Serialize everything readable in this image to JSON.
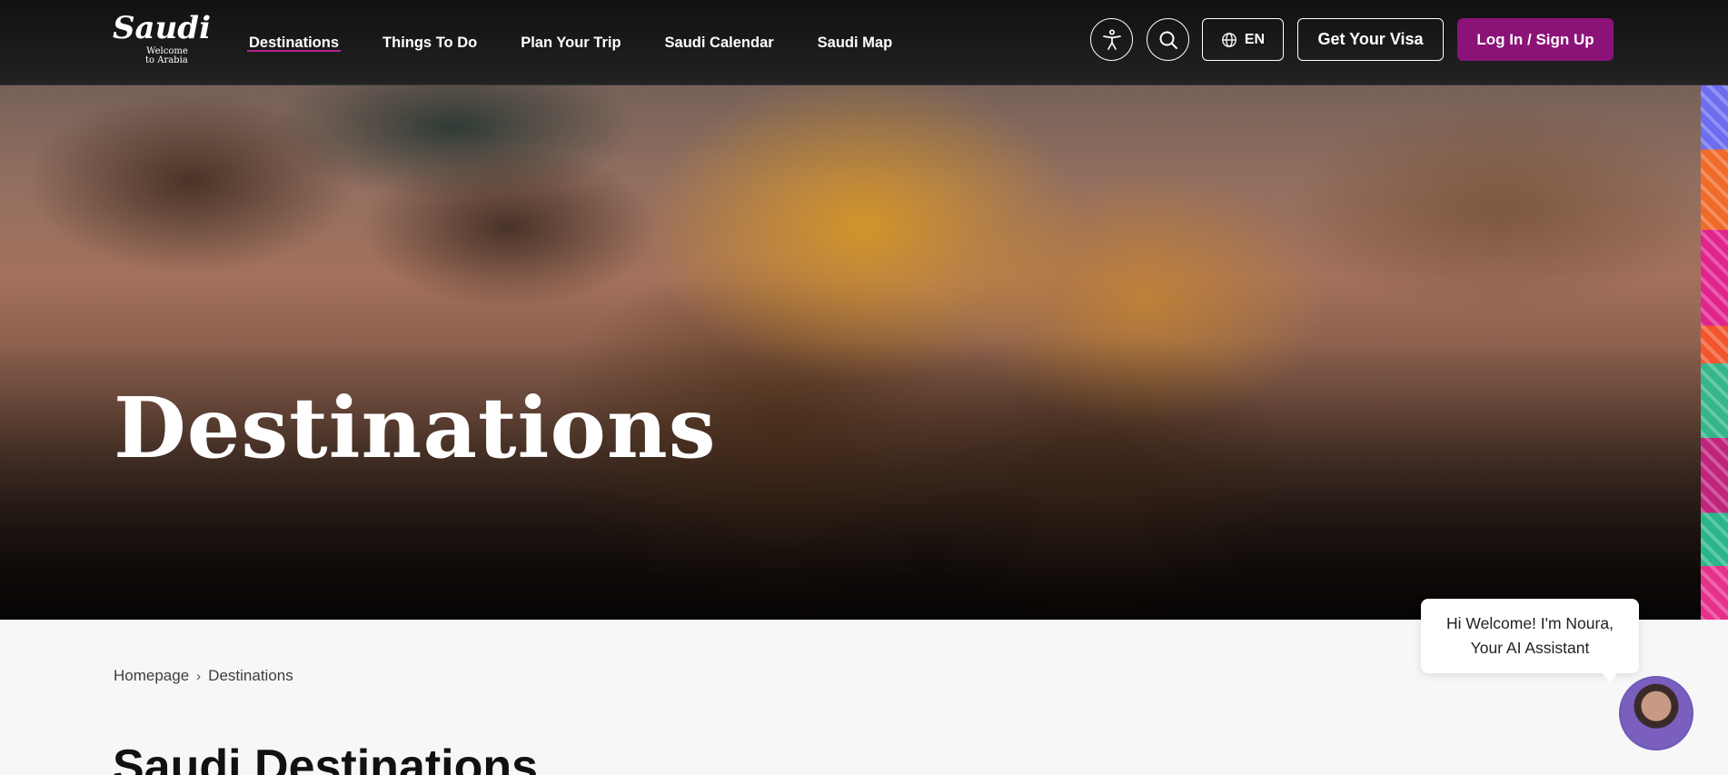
{
  "header": {
    "logo": {
      "main": "Saudi",
      "sub_line1": "Welcome",
      "sub_line2": "to Arabia"
    },
    "nav": [
      {
        "label": "Destinations",
        "active": true
      },
      {
        "label": "Things To Do",
        "active": false
      },
      {
        "label": "Plan Your Trip",
        "active": false
      },
      {
        "label": "Saudi Calendar",
        "active": false
      },
      {
        "label": "Saudi Map",
        "active": false
      }
    ],
    "icons": {
      "accessibility": "accessibility-icon",
      "search": "search-icon",
      "globe": "globe-icon"
    },
    "language": "EN",
    "visa_button": "Get Your Visa",
    "login_button": "Log In / Sign Up"
  },
  "hero": {
    "title": "Destinations"
  },
  "breadcrumb": {
    "home": "Homepage",
    "current": "Destinations"
  },
  "main": {
    "section_title": "Saudi Destinations"
  },
  "assistant": {
    "line1": "Hi Welcome! I'm Noura,",
    "line2": "Your AI Assistant"
  },
  "colors": {
    "accent": "#8b1378",
    "underline": "#b4238a",
    "header_bg": "#1a1a1a",
    "page_bg": "#f7f7f7"
  }
}
